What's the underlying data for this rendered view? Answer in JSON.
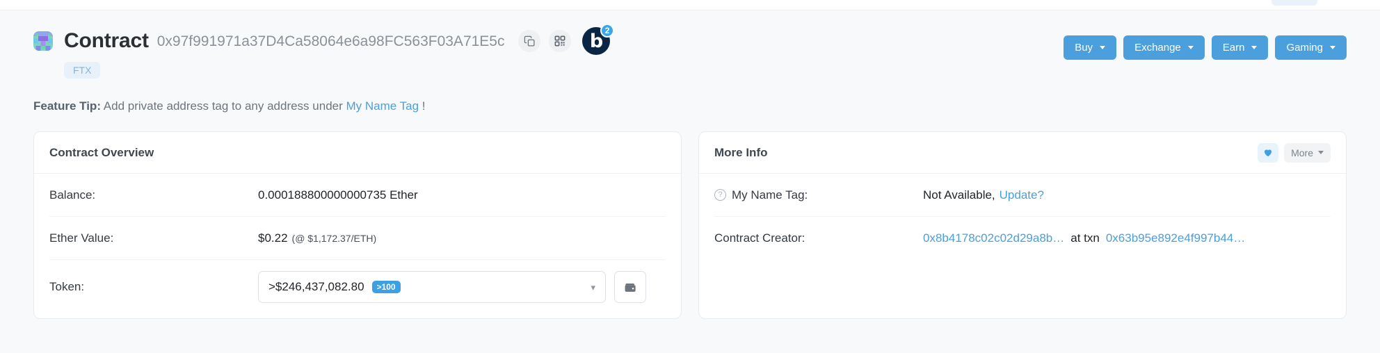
{
  "header": {
    "identicon_name": "address-identicon",
    "title": "Contract",
    "address": "0x97f991971a37D4Ca58064e6a98FC563F03A71E5c",
    "copy_icon": "copy-icon",
    "qr_icon": "qr-code-icon",
    "brand_badge_letter": "b",
    "brand_badge_count": "2",
    "tag": "FTX"
  },
  "actions": [
    {
      "label": "Buy"
    },
    {
      "label": "Exchange"
    },
    {
      "label": "Earn"
    },
    {
      "label": "Gaming"
    }
  ],
  "feature_tip": {
    "prefix": "Feature Tip:",
    "text": " Add private address tag to any address under ",
    "link": "My Name Tag",
    "suffix": " !"
  },
  "contract_overview": {
    "title": "Contract Overview",
    "balance_label": "Balance:",
    "balance_value": "0.000188800000000735 Ether",
    "ether_value_label": "Ether Value:",
    "ether_value": "$0.22",
    "ether_rate": "(@ $1,172.37/ETH)",
    "token_label": "Token:",
    "token_amount": ">$246,437,082.80",
    "token_badge": ">100",
    "wallet_icon": "wallet-icon"
  },
  "more_info": {
    "title": "More Info",
    "heart_icon": "heart-icon",
    "more_label": "More",
    "name_tag_label": "My Name Tag:",
    "name_tag_value": "Not Available,",
    "name_tag_link": "Update?",
    "creator_label": "Contract Creator:",
    "creator_address": "0x8b4178c02c02d29a8b…",
    "creator_sep": "at txn",
    "creator_txn": "0x63b95e892e4f997b44…"
  },
  "colors": {
    "accent": "#4a9fdc",
    "badge_blue": "#3da0e3",
    "brand_dark": "#0b2545",
    "page_bg": "#f8f9fa"
  }
}
